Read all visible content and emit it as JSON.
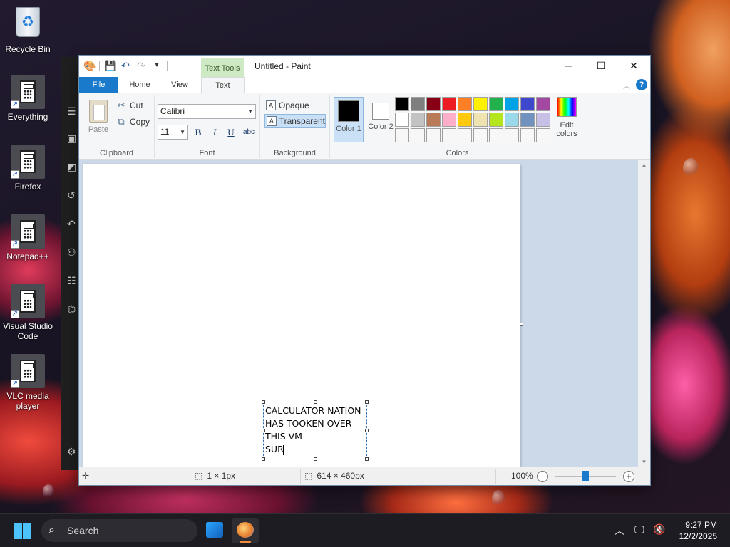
{
  "desktop": {
    "icons": [
      {
        "label": "Recycle Bin"
      },
      {
        "label": "Everything"
      },
      {
        "label": "Firefox"
      },
      {
        "label": "Notepad++"
      },
      {
        "label": "Visual Studio Code"
      },
      {
        "label": "VLC media player"
      }
    ]
  },
  "paint": {
    "title": "Untitled - Paint",
    "context_tab": "Text Tools",
    "tabs": [
      "File",
      "Home",
      "View",
      "Text"
    ],
    "active_tab": "Text",
    "clipboard": {
      "paste": "Paste",
      "cut": "Cut",
      "copy": "Copy",
      "label": "Clipboard"
    },
    "font": {
      "family": "Calibri",
      "size": "11",
      "bold": "B",
      "italic": "I",
      "underline": "U",
      "strikethrough": "abc",
      "label": "Font"
    },
    "background": {
      "opaque": "Opaque",
      "transparent": "Transparent",
      "selected": "Transparent",
      "label": "Background"
    },
    "colors": {
      "color1_label": "Color 1",
      "color2_label": "Color 2",
      "color1": "#000000",
      "color2": "#ffffff",
      "edit_colors": "Edit colors",
      "label": "Colors",
      "palette": [
        "#000000",
        "#7f7f7f",
        "#880015",
        "#ed1c24",
        "#ff7f27",
        "#fff200",
        "#22b14c",
        "#00a2e8",
        "#3f48cc",
        "#a349a4",
        "#ffffff",
        "#c3c3c3",
        "#b97a57",
        "#ffaec9",
        "#ffc90e",
        "#efe4b0",
        "#b5e61d",
        "#99d9ea",
        "#7092be",
        "#c8bfe7",
        "#f7f7f7",
        "#f7f7f7",
        "#f7f7f7",
        "#f7f7f7",
        "#f7f7f7",
        "#f7f7f7",
        "#f7f7f7",
        "#f7f7f7",
        "#f7f7f7",
        "#f7f7f7"
      ]
    },
    "canvas_text": [
      "CALCULATOR NATION",
      "HAS TOOKEN OVER",
      "THIS VM",
      "SUR"
    ],
    "status": {
      "selection_size": "1 × 1px",
      "image_size": "614 × 460px",
      "zoom": "100%"
    }
  },
  "taskbar": {
    "search_placeholder": "Search",
    "time": "9:27 PM",
    "date": "12/2/2025"
  }
}
